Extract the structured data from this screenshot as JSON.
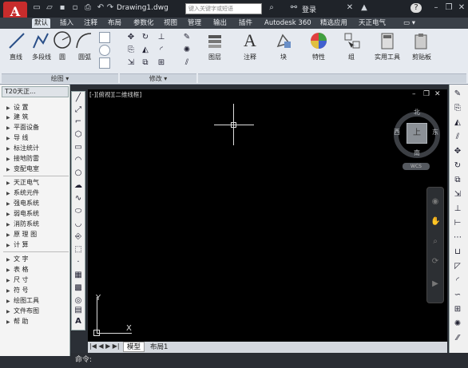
{
  "app": {
    "logo": "A",
    "document_title": "Drawing1.dwg",
    "search_placeholder": "键入关键字或短语",
    "signin_label": "登录",
    "help_label": "?"
  },
  "tabs": [
    "默认",
    "插入",
    "注释",
    "布局",
    "参数化",
    "视图",
    "管理",
    "输出",
    "插件",
    "Autodesk 360",
    "精选应用",
    "天正电气"
  ],
  "ribbon": {
    "draw_tools": [
      "直线",
      "多段线",
      "圆",
      "圆弧"
    ],
    "draw_panel": "绘图",
    "modify_panel": "修改",
    "big_tools": [
      "图层",
      "注释",
      "块",
      "特性",
      "组",
      "实用工具",
      "剪贴板"
    ]
  },
  "left_panel": {
    "title": "T20天正...",
    "groups": [
      [
        "设 置",
        "建 筑",
        "平面设备",
        "导 线",
        "标注统计",
        "接地防雷",
        "变配电室"
      ],
      [
        "天正电气",
        "系统元件",
        "强电系统",
        "弱电系统",
        "消防系统",
        "原 理 图",
        "计 算"
      ],
      [
        "文 字",
        "表 格",
        "尺 寸",
        "符 号",
        "绘图工具",
        "文件布图",
        "帮 助"
      ]
    ]
  },
  "viewport": {
    "label": "[-][俯视][二维线框]",
    "viewcube": {
      "top": "上",
      "north": "北",
      "south": "南",
      "east": "东",
      "west": "西",
      "wcs": "WCS"
    },
    "ucs_x": "X",
    "ucs_y": "Y"
  },
  "layout_tabs": [
    "模型",
    "布局1"
  ],
  "command": {
    "prompt": "命令:"
  },
  "colors": {
    "accent": "#c72c2c",
    "canvas": "#000000",
    "ribbon": "#e6eaf0"
  }
}
